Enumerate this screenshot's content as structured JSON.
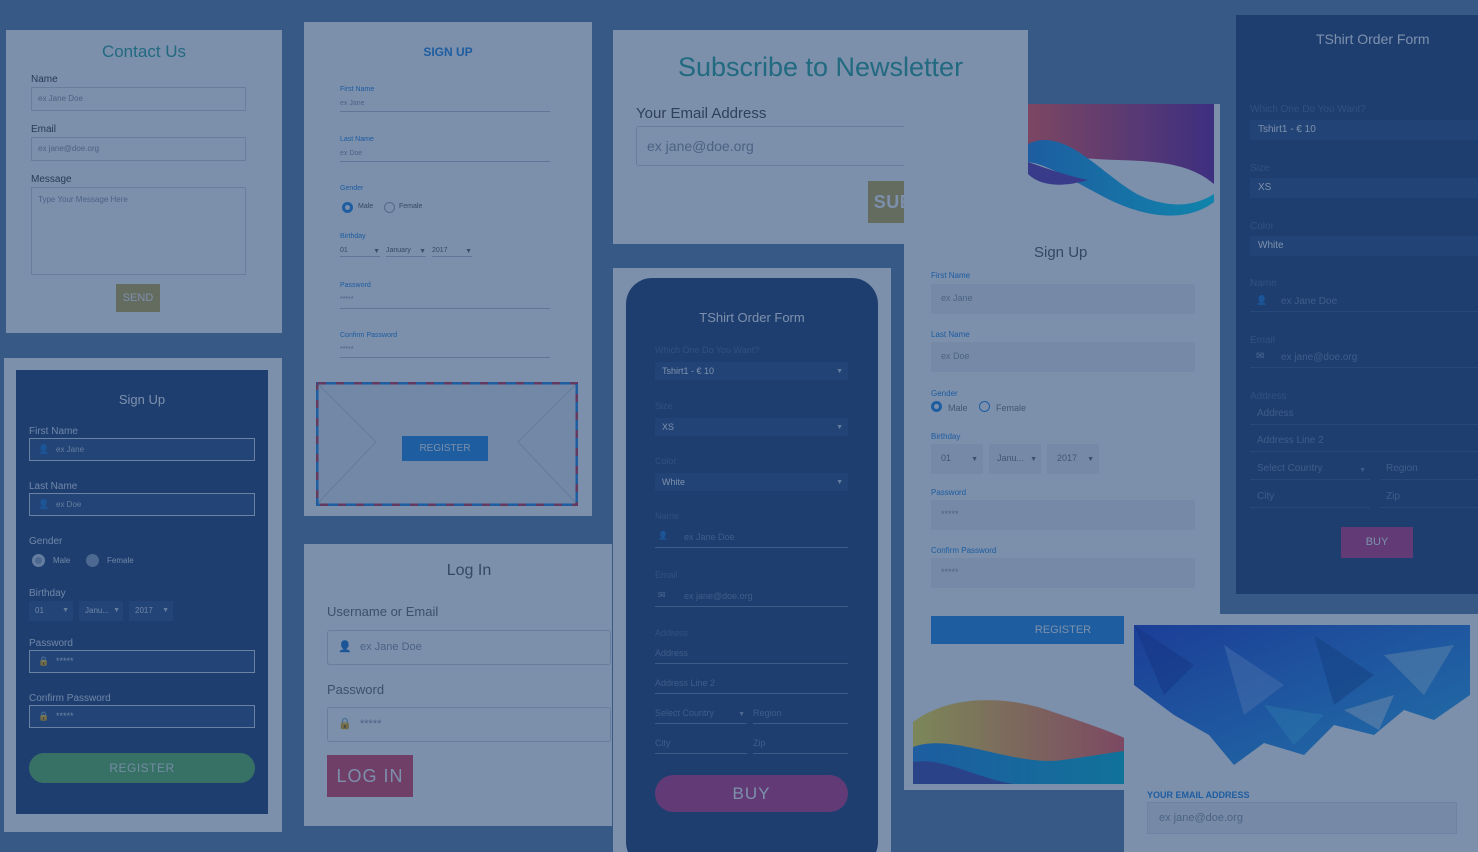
{
  "contact": {
    "title": "Contact Us",
    "name_label": "Name",
    "name_placeholder": "ex Jane Doe",
    "email_label": "Email",
    "email_placeholder": "ex jane@doe.org",
    "message_label": "Message",
    "message_placeholder": "Type Your Message Here",
    "send_label": "SEND"
  },
  "signup_envelope": {
    "title": "SIGN UP",
    "first_label": "First Name",
    "first_placeholder": "ex Jane",
    "last_label": "Last Name",
    "last_placeholder": "ex Doe",
    "gender_label": "Gender",
    "male": "Male",
    "female": "Female",
    "birthday_label": "Birthday",
    "day": "01",
    "month": "January",
    "year": "2017",
    "password_label": "Password",
    "password_value": "*****",
    "confirm_label": "Confirm Password",
    "confirm_value": "*****",
    "register_label": "REGISTER"
  },
  "newsletter": {
    "title": "Subscribe to Newsletter",
    "email_label": "Your Email Address",
    "email_placeholder": "ex jane@doe.org",
    "subscribe_label": "SUBSCRIBE"
  },
  "signup_dark": {
    "title": "Sign Up",
    "first_label": "First Name",
    "first_placeholder": "ex Jane",
    "last_label": "Last Name",
    "last_placeholder": "ex Doe",
    "gender_label": "Gender",
    "male": "Male",
    "female": "Female",
    "birthday_label": "Birthday",
    "day": "01",
    "month": "Janu...",
    "year": "2017",
    "password_label": "Password",
    "password_value": "*****",
    "confirm_label": "Confirm Password",
    "confirm_value": "*****",
    "register_label": "REGISTER"
  },
  "login": {
    "title": "Log In",
    "user_label": "Username or Email",
    "user_placeholder": "ex Jane Doe",
    "password_label": "Password",
    "password_placeholder": "*****",
    "login_label": "LOG IN"
  },
  "tshirt_center": {
    "title": "TShirt Order Form",
    "which_label": "Which One Do You Want?",
    "which_value": "Tshirt1 - € 10",
    "size_label": "Size",
    "size_value": "XS",
    "color_label": "Color",
    "color_value": "White",
    "name_label": "Name",
    "name_placeholder": "ex Jane Doe",
    "email_label": "Email",
    "email_placeholder": "ex jane@doe.org",
    "address_label": "Address",
    "address_placeholder": "Address",
    "address2_placeholder": "Address Line 2",
    "country_placeholder": "Select Country",
    "region_placeholder": "Region",
    "city_placeholder": "City",
    "zip_placeholder": "Zip",
    "buy_label": "BUY"
  },
  "signup_wave": {
    "title": "Sign Up",
    "first_label": "First Name",
    "first_placeholder": "ex Jane",
    "last_label": "Last Name",
    "last_placeholder": "ex Doe",
    "gender_label": "Gender",
    "male": "Male",
    "female": "Female",
    "birthday_label": "Birthday",
    "day": "01",
    "month": "Janu...",
    "year": "2017",
    "password_label": "Password",
    "password_value": "*****",
    "confirm_label": "Confirm Password",
    "confirm_value": "*****",
    "register_label": "REGISTER"
  },
  "tshirt_right": {
    "title": "TShirt Order Form",
    "which_label": "Which One Do You Want?",
    "which_value": "Tshirt1 - € 10",
    "size_label": "Size",
    "size_value": "XS",
    "color_label": "Color",
    "color_value": "White",
    "name_label": "Name",
    "name_placeholder": "ex Jane Doe",
    "email_label": "Email",
    "email_placeholder": "ex jane@doe.org",
    "address_label": "Address",
    "address_placeholder": "Address",
    "address2_placeholder": "Address Line 2",
    "country_placeholder": "Select Country",
    "region_placeholder": "Region",
    "city_placeholder": "City",
    "zip_placeholder": "Zip",
    "buy_label": "BUY"
  },
  "newsletter_poly": {
    "email_label": "YOUR EMAIL ADDRESS",
    "email_placeholder": "ex jane@doe.org"
  },
  "colors": {
    "overlay": "#1e3e6e",
    "accent_blue": "#1e88e5",
    "dark_navy": "#1f3f73",
    "green_button": "#4caf50",
    "teal_title": "#26a69a",
    "gold_button": "#b59a3a",
    "red_button": "#c0324f",
    "pink_button": "#c2357f"
  }
}
